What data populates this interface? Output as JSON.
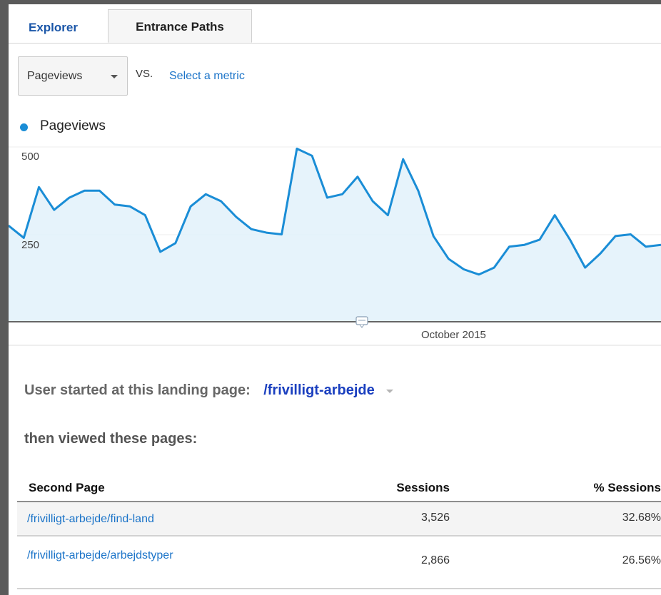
{
  "tabs": [
    {
      "label": "Explorer",
      "active": false
    },
    {
      "label": "Entrance Paths",
      "active": true
    }
  ],
  "metric_selector": {
    "primary": "Pageviews",
    "vs_label": "VS.",
    "secondary_link": "Select a metric"
  },
  "colors": {
    "accent": "#1a8dd6",
    "area_fill": "#e2f1fa",
    "link": "#1a73c8",
    "landing_link": "#1a3fbf"
  },
  "chart_data": {
    "type": "area",
    "series": [
      {
        "name": "Pageviews",
        "values": [
          275,
          240,
          385,
          320,
          355,
          375,
          375,
          335,
          330,
          305,
          200,
          225,
          330,
          365,
          345,
          300,
          265,
          255,
          250,
          495,
          475,
          355,
          365,
          415,
          345,
          305,
          465,
          375,
          245,
          180,
          150,
          135,
          155,
          215,
          220,
          235,
          305,
          235,
          155,
          195,
          245,
          250,
          215,
          220
        ]
      }
    ],
    "y_ticks": [
      "500",
      "250"
    ],
    "x_label": "October 2015",
    "ylim": [
      0,
      500
    ],
    "grid": true
  },
  "icons": {
    "dropdown": "caret-down-icon",
    "annotation": "annotation-icon",
    "landing_dropdown": "caret-down-icon"
  },
  "landing": {
    "label": "User started at this landing page:",
    "page": "/frivilligt-arbejde",
    "then_label": "then viewed these pages:"
  },
  "table": {
    "headers": {
      "page": "Second Page",
      "sessions": "Sessions",
      "pct": "% Sessions"
    },
    "rows": [
      {
        "page": "/frivilligt-arbejde/find-land",
        "sessions": "3,526",
        "pct": "32.68%"
      },
      {
        "page": "/frivilligt-arbejde/arbejdstyper",
        "sessions": "2,866",
        "pct": "26.56%"
      }
    ]
  }
}
